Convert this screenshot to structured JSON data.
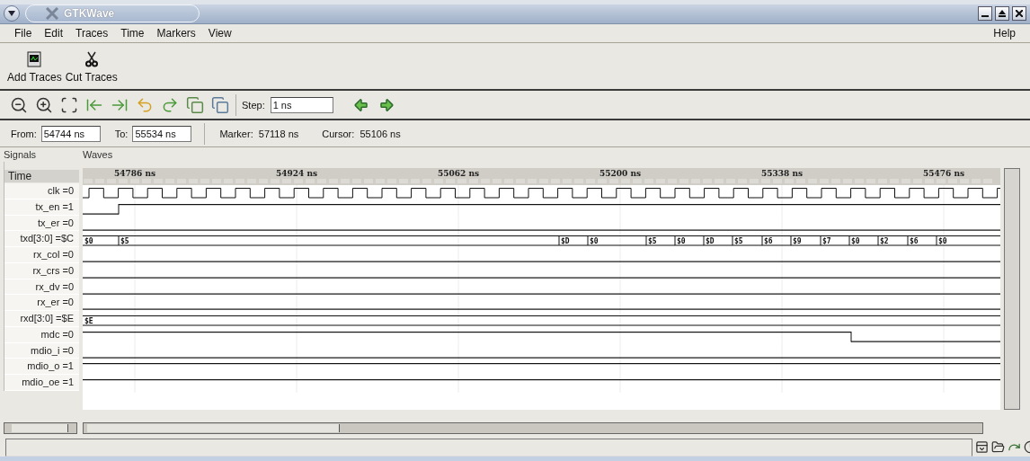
{
  "window": {
    "title": "GTKWave"
  },
  "menu": [
    {
      "label": "File"
    },
    {
      "label": "Edit"
    },
    {
      "label": "Traces"
    },
    {
      "label": "Time"
    },
    {
      "label": "Markers"
    },
    {
      "label": "View"
    }
  ],
  "help_menu": {
    "label": "Help"
  },
  "toolbar": [
    {
      "kind": "add",
      "label": "Add Traces"
    },
    {
      "kind": "cut",
      "label": "Cut Traces"
    }
  ],
  "nav_tools": [
    {
      "kind": "zoom-out"
    },
    {
      "kind": "zoom-in"
    },
    {
      "kind": "zoom-fit"
    },
    {
      "kind": "to-start"
    },
    {
      "kind": "to-end"
    },
    {
      "kind": "undo"
    },
    {
      "kind": "redo"
    },
    {
      "kind": "page-left"
    },
    {
      "kind": "page-right"
    }
  ],
  "step": {
    "label": "Step:",
    "value": "1 ns"
  },
  "step_arrows": [
    {
      "kind": "left"
    },
    {
      "kind": "right"
    }
  ],
  "range": {
    "from_label": "From:",
    "from": "54744 ns",
    "to_label": "To:",
    "to": "55534 ns",
    "marker": "Marker:  57118 ns",
    "cursor": "Cursor:  55106 ns"
  },
  "signals_pane": {
    "title": "Signals",
    "header": "Time"
  },
  "waves_pane": {
    "title": "Waves",
    "ticks": [
      "54786 ns",
      "54924 ns",
      "55062 ns",
      "55200 ns",
      "55338 ns",
      "55476 ns"
    ]
  },
  "signals": [
    {
      "label": "clk =0",
      "kind": "clock"
    },
    {
      "label": "tx_en =1",
      "kind": "bit",
      "segments": [
        {
          "high": false
        },
        {
          "high": true
        }
      ]
    },
    {
      "label": "tx_er =0",
      "kind": "bit",
      "segments": [
        {
          "high": false
        }
      ]
    },
    {
      "label": "txd[3:0] =$C",
      "kind": "bus",
      "segments": [
        {
          "label": "$0"
        },
        {
          "label": "$5"
        },
        {
          "label": "$D"
        },
        {
          "label": "$0"
        },
        {
          "label": "$5"
        },
        {
          "label": "$0"
        },
        {
          "label": "$D"
        },
        {
          "label": "$5"
        },
        {
          "label": "$6"
        },
        {
          "label": "$9"
        },
        {
          "label": "$7"
        },
        {
          "label": "$0"
        },
        {
          "label": "$2"
        },
        {
          "label": "$6"
        },
        {
          "label": "$0"
        }
      ]
    },
    {
      "label": "rx_col =0",
      "kind": "bit",
      "segments": [
        {
          "high": false
        }
      ]
    },
    {
      "label": "rx_crs =0",
      "kind": "bit",
      "segments": [
        {
          "high": false
        }
      ]
    },
    {
      "label": "rx_dv =0",
      "kind": "bit",
      "segments": [
        {
          "high": false
        }
      ]
    },
    {
      "label": "rx_er =0",
      "kind": "bit",
      "segments": [
        {
          "high": false
        }
      ]
    },
    {
      "label": "rxd[3:0] =$E",
      "kind": "bus",
      "segments": [
        {
          "label": "$E"
        }
      ]
    },
    {
      "label": "mdc =0",
      "kind": "bit",
      "segments": [
        {
          "high": true
        },
        {
          "high": false
        }
      ]
    },
    {
      "label": "mdio_i =0",
      "kind": "bit",
      "segments": [
        {
          "high": false
        }
      ]
    },
    {
      "label": "mdio_o =1",
      "kind": "bit",
      "segments": [
        {
          "high": true
        }
      ]
    },
    {
      "label": "mdio_oe =1",
      "kind": "bit",
      "segments": [
        {
          "high": true
        }
      ]
    }
  ]
}
